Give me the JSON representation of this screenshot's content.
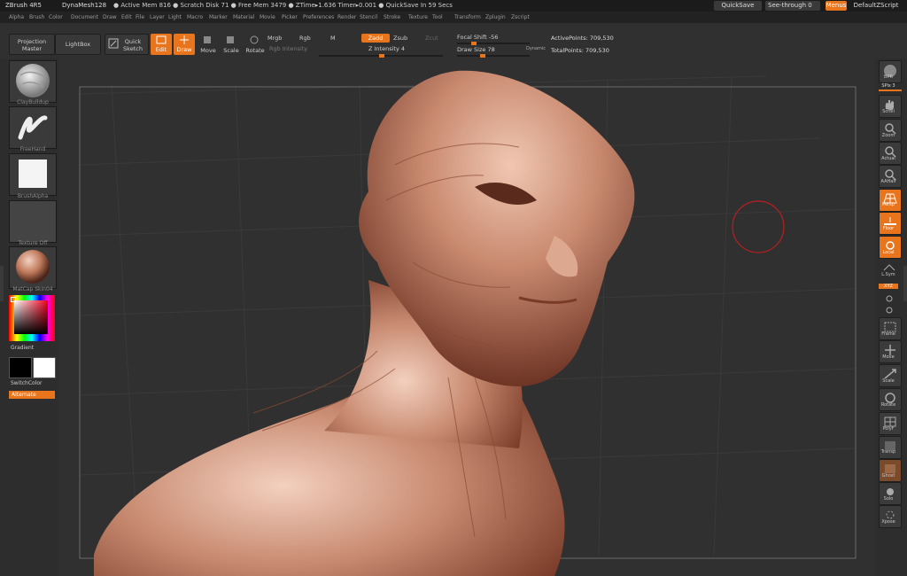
{
  "titlebar": {
    "app": "ZBrush 4R5",
    "document": "DynaMesh128",
    "status": "● Active Mem 816 ● Scratch Disk 71 ● Free Mem 3479 ● ZTime▸1.636 Timer▸0.001 ● QuickSave In 59 Secs",
    "quicksave": "QuickSave",
    "see_through": "See-through  0",
    "menus": "Menus",
    "script": "DefaultZScript"
  },
  "menus": [
    "Alpha",
    "Brush",
    "Color",
    "Document",
    "Draw",
    "Edit",
    "File",
    "Layer",
    "Light",
    "Macro",
    "Marker",
    "Material",
    "Movie",
    "Picker",
    "Preferences",
    "Render",
    "Stencil",
    "Stroke",
    "Texture",
    "Tool",
    "Transform",
    "Zplugin",
    "Zscript"
  ],
  "toolbar": {
    "projection_master": "Projection Master",
    "lightbox": "LightBox",
    "quick_sketch": "Quick Sketch",
    "edit": "Edit",
    "draw": "Draw",
    "move": "Move",
    "scale": "Scale",
    "rotate": "Rotate",
    "mrgb": "Mrgb",
    "rgb": "Rgb",
    "m": "M",
    "rgb_intensity": "Rgb Intensity",
    "zadd": "Zadd",
    "zsub": "Zsub",
    "zcut": "Zcut",
    "z_intensity": "Z Intensity 4",
    "focal_shift": "Focal Shift -56",
    "draw_size": "Draw Size 78",
    "dynamic": "Dynamic",
    "active_points": "ActivePoints: 709,530",
    "total_points": "TotalPoints: 709,530"
  },
  "left": {
    "brush_label": "ClayBuildup",
    "stroke_label": "FreeHand",
    "alpha_label": "BrushAlpha",
    "texture_label": "Texture Off",
    "material_label": "MatCap Skin04",
    "gradient": "Gradient",
    "switch_color": "SwitchColor",
    "alternate": "Alternate"
  },
  "right": {
    "bpr": "BPR",
    "spix": "SPix 3",
    "scroll": "Scroll",
    "zoom": "Zoom",
    "actual": "Actual",
    "aahalf": "AAHalf",
    "persp": "Persp",
    "floor": "Floor",
    "local": "Local",
    "lsym": "L.Sym",
    "xyz": "XYZ",
    "frame": "Frame",
    "move": "Move",
    "scale": "Scale",
    "rotate": "Rotate",
    "polyf": "PolyF",
    "transp": "Transp",
    "ghost": "Ghost",
    "solo": "Solo",
    "xpose": "Xpose"
  },
  "colors": {
    "accent": "#e8741c",
    "skin": "#c98a70",
    "background": "#2a2a2a"
  }
}
